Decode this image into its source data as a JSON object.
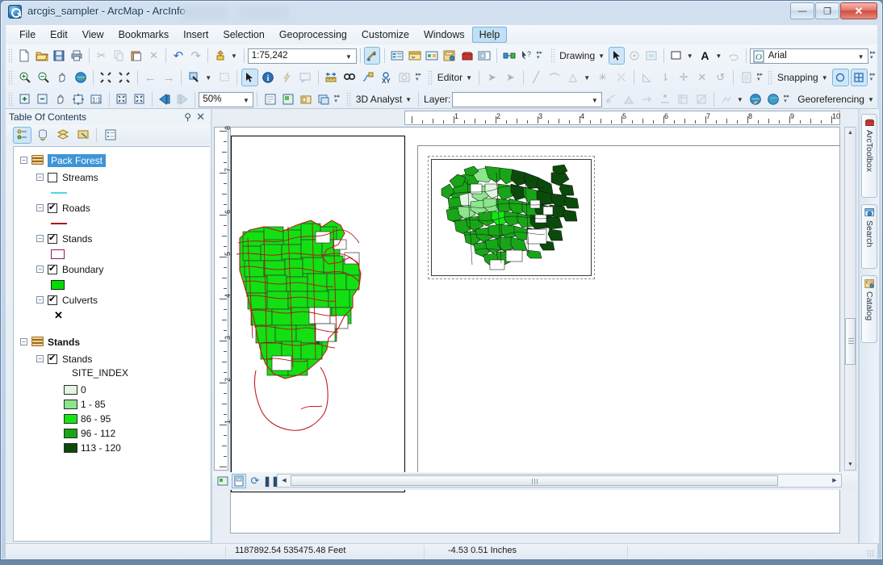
{
  "window": {
    "title": "arcgis_sampler - ArcMap - ArcInfo",
    "minimize_label": "—",
    "restore_label": "❐",
    "close_label": "✕"
  },
  "menubar": {
    "items": [
      {
        "label": "File",
        "highlighted": false
      },
      {
        "label": "Edit",
        "highlighted": false
      },
      {
        "label": "View",
        "highlighted": false
      },
      {
        "label": "Bookmarks",
        "highlighted": false
      },
      {
        "label": "Insert",
        "highlighted": false
      },
      {
        "label": "Selection",
        "highlighted": false
      },
      {
        "label": "Geoprocessing",
        "highlighted": false
      },
      {
        "label": "Customize",
        "highlighted": false
      },
      {
        "label": "Windows",
        "highlighted": false
      },
      {
        "label": "Help",
        "highlighted": true
      }
    ]
  },
  "toolbars": {
    "standard": {
      "scale_value": "1:75,242",
      "icons": [
        "new-document-icon",
        "open-folder-icon",
        "save-icon",
        "print-icon",
        "cut-icon",
        "copy-icon",
        "paste-icon",
        "delete-icon",
        "undo-icon",
        "redo-icon",
        "add-data-icon",
        "editor-toolbar-icon",
        "table-of-contents-icon",
        "python-window-icon",
        "model-builder-icon",
        "catalog-icon",
        "arctoolbox-icon",
        "layout-view-icon",
        "link-icon",
        "whats-this-icon"
      ]
    },
    "tools": {
      "icons": [
        "zoom-in-icon",
        "zoom-out-icon",
        "pan-icon",
        "full-extent-icon",
        "fixed-zoom-in-icon",
        "fixed-zoom-out-icon",
        "previous-extent-icon",
        "next-extent-icon",
        "select-features-icon",
        "clear-selection-icon",
        "select-elements-icon",
        "identify-icon",
        "hyperlink-icon",
        "html-popup-icon",
        "measure-icon",
        "find-icon",
        "find-route-icon",
        "go-to-xy-icon",
        "time-slider-icon"
      ]
    },
    "layout": {
      "zoom_value": "50%",
      "icons": [
        "zoom-in-page-icon",
        "zoom-out-page-icon",
        "pan-page-icon",
        "zoom-whole-page-icon",
        "zoom-100-icon",
        "fixed-zoom-in-page-icon",
        "fixed-zoom-out-page-icon",
        "go-back-extent-icon",
        "go-forward-extent-icon",
        "toggle-draft-mode-icon",
        "focus-data-frame-icon",
        "change-layout-icon",
        "data-driven-pages-icon"
      ]
    },
    "drawing": {
      "label": "Drawing",
      "font_name": "Arial",
      "icons": [
        "select-elements-icon",
        "rotate-icon",
        "edit-vertices-icon",
        "fill-color-icon",
        "font-color-icon",
        "drawing-lasso-icon",
        "font-icon"
      ]
    },
    "editor": {
      "label": "Editor",
      "icons": [
        "edit-tool-icon",
        "edit-annotation-icon",
        "straight-segment-icon",
        "end-point-arc-icon",
        "trace-icon",
        "midpoint-icon",
        "intersection-icon",
        "construction-tool-icon",
        "split-icon",
        "rotate-edit-icon",
        "attributes-icon"
      ]
    },
    "snapping": {
      "label": "Snapping",
      "icons": [
        "point-snapping-icon",
        "grid-snapping-icon"
      ]
    },
    "analyst3d": {
      "label": "3D Analyst",
      "layer_label": "Layer:",
      "layer_value": ""
    },
    "georeferencing": {
      "label": "Georeferencing",
      "icons": [
        "rotate-raster-icon",
        "shift-raster-icon",
        "scale-raster-icon",
        "add-control-points-icon",
        "view-link-table-icon",
        "rectify-icon",
        "auto-adjust-icon",
        "update-georeferencing-icon",
        "flip-icon"
      ]
    }
  },
  "toc": {
    "title": "Table Of Contents",
    "pin_label": "⚲",
    "close_label": "✕",
    "tools": [
      "list-by-drawing-order-icon",
      "list-by-source-icon",
      "list-by-visibility-icon",
      "list-by-selection-icon",
      "options-icon"
    ],
    "data_frames": [
      {
        "name": "Pack Forest",
        "selected": true,
        "expanded": true,
        "layers": [
          {
            "name": "Streams",
            "checked": false,
            "symbol": "line",
            "color": "#4ed8e6"
          },
          {
            "name": "Roads",
            "checked": true,
            "symbol": "line",
            "color": "#b01414"
          },
          {
            "name": "Stands",
            "checked": true,
            "symbol": "polygon-outline",
            "color": "#8b1a6b"
          },
          {
            "name": "Boundary",
            "checked": true,
            "symbol": "polygon-fill",
            "color": "#00dd00"
          },
          {
            "name": "Culverts",
            "checked": true,
            "symbol": "x-marker",
            "color": "#000000"
          }
        ]
      },
      {
        "name": "Stands",
        "selected": false,
        "expanded": true,
        "layers": [
          {
            "name": "Stands",
            "checked": true,
            "symbol": "classified",
            "classification_field": "SITE_INDEX",
            "classes": [
              {
                "label": "0",
                "color": "#e2f5e2"
              },
              {
                "label": "1 - 85",
                "color": "#8ce68c"
              },
              {
                "label": "86 - 95",
                "color": "#14e614"
              },
              {
                "label": "96 - 112",
                "color": "#18a518"
              },
              {
                "label": "113 - 120",
                "color": "#0b4a0b"
              }
            ]
          }
        ]
      }
    ]
  },
  "rulers": {
    "horizontal_ticks": [
      "1",
      "2",
      "3",
      "4",
      "5",
      "6",
      "7",
      "8",
      "9",
      "10"
    ],
    "vertical_ticks": [
      "1",
      "2",
      "3",
      "4",
      "5",
      "6",
      "7",
      "8"
    ],
    "units": "Inches"
  },
  "layout_view": {
    "data_frame_selected": true,
    "inset_title": ""
  },
  "bottombar": {
    "buttons": [
      "data-view-icon",
      "layout-view-icon",
      "refresh-icon",
      "pause-drawing-icon"
    ],
    "selected_button": "layout-view-icon"
  },
  "right_dock": {
    "tabs": [
      {
        "label": "ArcToolbox",
        "icon": "arctoolbox-icon"
      },
      {
        "label": "Search",
        "icon": "search-icon"
      },
      {
        "label": "Catalog",
        "icon": "catalog-icon"
      }
    ]
  },
  "statusbar": {
    "map_coordinates": "1187892.54  535475.48 Feet",
    "page_coordinates": "-4.53  0.51 Inches"
  },
  "colors": {
    "accent": "#3d95d8",
    "title_text": "#123a5e",
    "roads": "#b01414",
    "boundary": "#00dd00",
    "stands_outline": "#8b1a6b"
  }
}
